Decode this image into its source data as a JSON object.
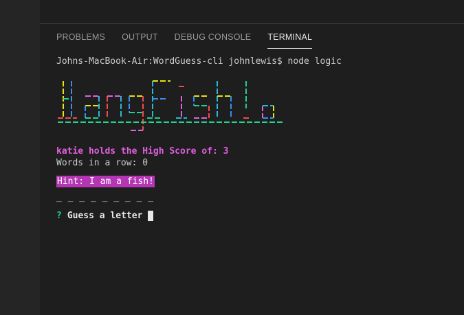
{
  "panel": {
    "tabs": [
      {
        "label": "PROBLEMS"
      },
      {
        "label": "OUTPUT"
      },
      {
        "label": "DEBUG CONSOLE"
      },
      {
        "label": "TERMINAL"
      }
    ],
    "active_tab": "TERMINAL"
  },
  "terminal": {
    "command_line": "Johns-MacBook-Air:WordGuess-cli johnlewis$ node logic",
    "banner_text": "HangFish!",
    "high_score_line": "katie holds the High Score of: 3",
    "words_in_row_line": "Words in a row: 0",
    "hint_line": "Hint: I am a fish!",
    "blanks_line": "_ _ _ _ _ _ _ _ _",
    "prompt_mark": "?",
    "prompt_text": "Guess a letter"
  },
  "colors": {
    "background": "#1e1e1e",
    "sidebar": "#252526",
    "score": "#e35fe3",
    "hint_bg": "#b535b5",
    "prompt_mark": "#23d18b",
    "banner_palette": [
      "#e5e510",
      "#3b8eea",
      "#23d18b",
      "#f14c4c",
      "#e35fe3",
      "#29b8db"
    ]
  }
}
